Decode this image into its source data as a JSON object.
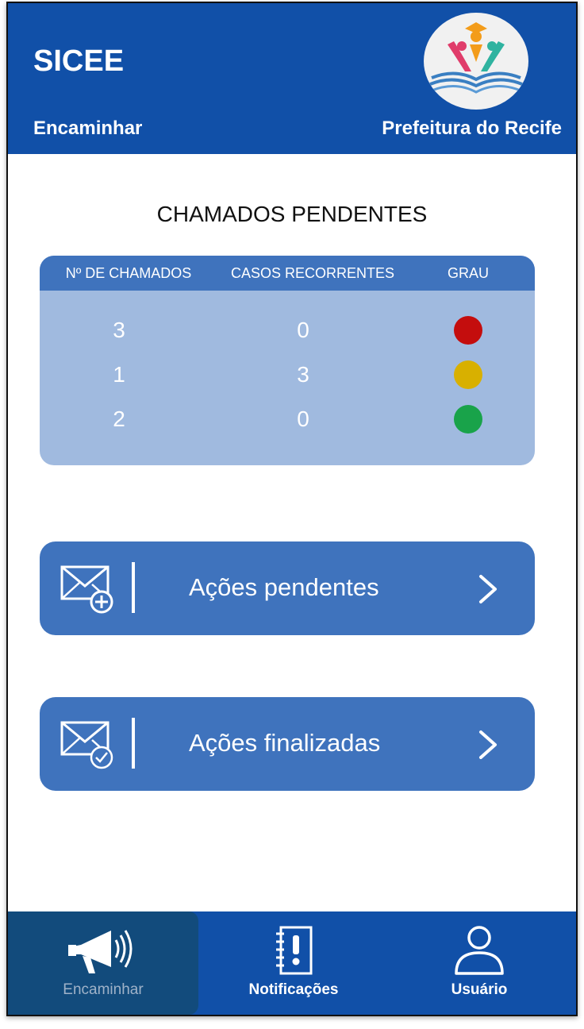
{
  "header": {
    "app_title": "SICEE",
    "subtitle": "Encaminhar",
    "organization": "Prefeitura do Recife"
  },
  "pending": {
    "title": "CHAMADOS PENDENTES",
    "columns": [
      "Nº DE CHAMADOS",
      "CASOS RECORRENTES",
      "GRAU"
    ],
    "rows": [
      {
        "chamados": "3",
        "recorrentes": "0",
        "grau_color": "#c40d0d"
      },
      {
        "chamados": "1",
        "recorrentes": "3",
        "grau_color": "#d8b000"
      },
      {
        "chamados": "2",
        "recorrentes": "0",
        "grau_color": "#19a34a"
      }
    ]
  },
  "actions": [
    {
      "label": "Ações pendentes",
      "icon": "mail-plus-icon"
    },
    {
      "label": "Ações finalizadas",
      "icon": "mail-check-icon"
    }
  ],
  "nav": [
    {
      "label": "Encaminhar",
      "icon": "megaphone-icon",
      "active": true
    },
    {
      "label": "Notificações",
      "icon": "notebook-alert-icon",
      "active": false
    },
    {
      "label": "Usuário",
      "icon": "user-icon",
      "active": false
    }
  ],
  "colors": {
    "primary": "#1150a8",
    "accent": "#3f73bd",
    "table_body": "#a0badf"
  }
}
